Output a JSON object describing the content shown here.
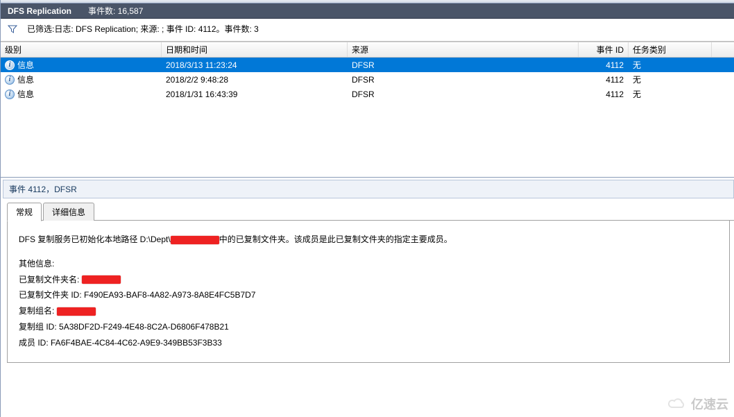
{
  "header": {
    "title": "DFS Replication",
    "count_label": "事件数: 16,587"
  },
  "filter": {
    "text": "已筛选:日志: DFS Replication; 来源: ; 事件 ID: 4112。事件数: 3"
  },
  "columns": {
    "level": "级别",
    "datetime": "日期和时间",
    "source": "来源",
    "event_id": "事件 ID",
    "category": "任务类别"
  },
  "rows": [
    {
      "level": "信息",
      "datetime": "2018/3/13 11:23:24",
      "source": "DFSR",
      "event_id": "4112",
      "category": "无",
      "selected": true
    },
    {
      "level": "信息",
      "datetime": "2018/2/2 9:48:28",
      "source": "DFSR",
      "event_id": "4112",
      "category": "无",
      "selected": false
    },
    {
      "level": "信息",
      "datetime": "2018/1/31 16:43:39",
      "source": "DFSR",
      "event_id": "4112",
      "category": "无",
      "selected": false
    }
  ],
  "detail": {
    "title": "事件 4112，DFSR",
    "tabs": {
      "general": "常规",
      "details": "详细信息"
    },
    "body": {
      "line1_prefix": "DFS 复制服务已初始化本地路径 D:\\Dept\\",
      "line1_suffix": "中的已复制文件夹。该成员是此已复制文件夹的指定主要成员。",
      "other_info": "其他信息:",
      "folder_name_label": "已复制文件夹名: ",
      "folder_id_label": "已复制文件夹 ID: ",
      "folder_id": "F490EA93-BAF8-4A82-A973-8A8E4FC5B7D7",
      "group_name_label": "复制组名: ",
      "group_id_label": "复制组 ID: ",
      "group_id": "5A38DF2D-F249-4E48-8C2A-D6806F478B21",
      "member_id_label": "成员 ID: ",
      "member_id": "FA6F4BAE-4C84-4C62-A9E9-349BB53F3B33"
    }
  },
  "watermark": "亿速云"
}
